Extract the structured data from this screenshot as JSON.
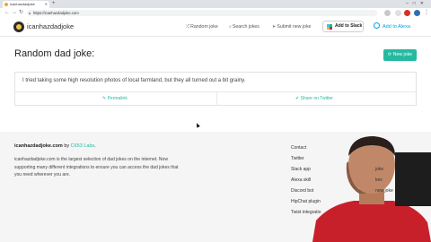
{
  "browser": {
    "tab_title": "icanhazdadjoke",
    "url": "https://icanhazdadjoke.com"
  },
  "header": {
    "brand": "icanhazdadjoke",
    "nav": [
      {
        "icon": "shuffle-icon",
        "label": "Random joke"
      },
      {
        "icon": "search-icon",
        "label": "Search jokes"
      },
      {
        "icon": "send-icon",
        "label": "Submit new joke"
      }
    ],
    "slack_label": "Add to Slack",
    "alexa_label": "Add to Alexa"
  },
  "main": {
    "title": "Random dad joke:",
    "new_joke_label": "New joke",
    "joke": "I tried taking some high resolution photos of local farmland, but they all turned out a bit grainy.",
    "permalink_label": "Permalink",
    "twitter_label": "Share on Twitter"
  },
  "footer": {
    "site": "icanhazdadjoke.com",
    "by": "by",
    "company": "C653 Labs",
    "period": ".",
    "description": "icanhazdadjoke.com is the largest selection of dad jokes on the internet. Now supporting many different integrations to ensure you can access the dad jokes that you need wherever you are.",
    "links": [
      "Contact",
      "Twitter",
      "Slack app",
      "Alexa skill",
      "Discord bot",
      "HipChat plugin",
      "Twist integratio"
    ],
    "links_right": [
      "joke",
      "kes",
      "new joke"
    ]
  },
  "colors": {
    "accent": "#26b9a0",
    "alexa": "#00a5d9",
    "footer_bg": "#f5f5f5"
  }
}
